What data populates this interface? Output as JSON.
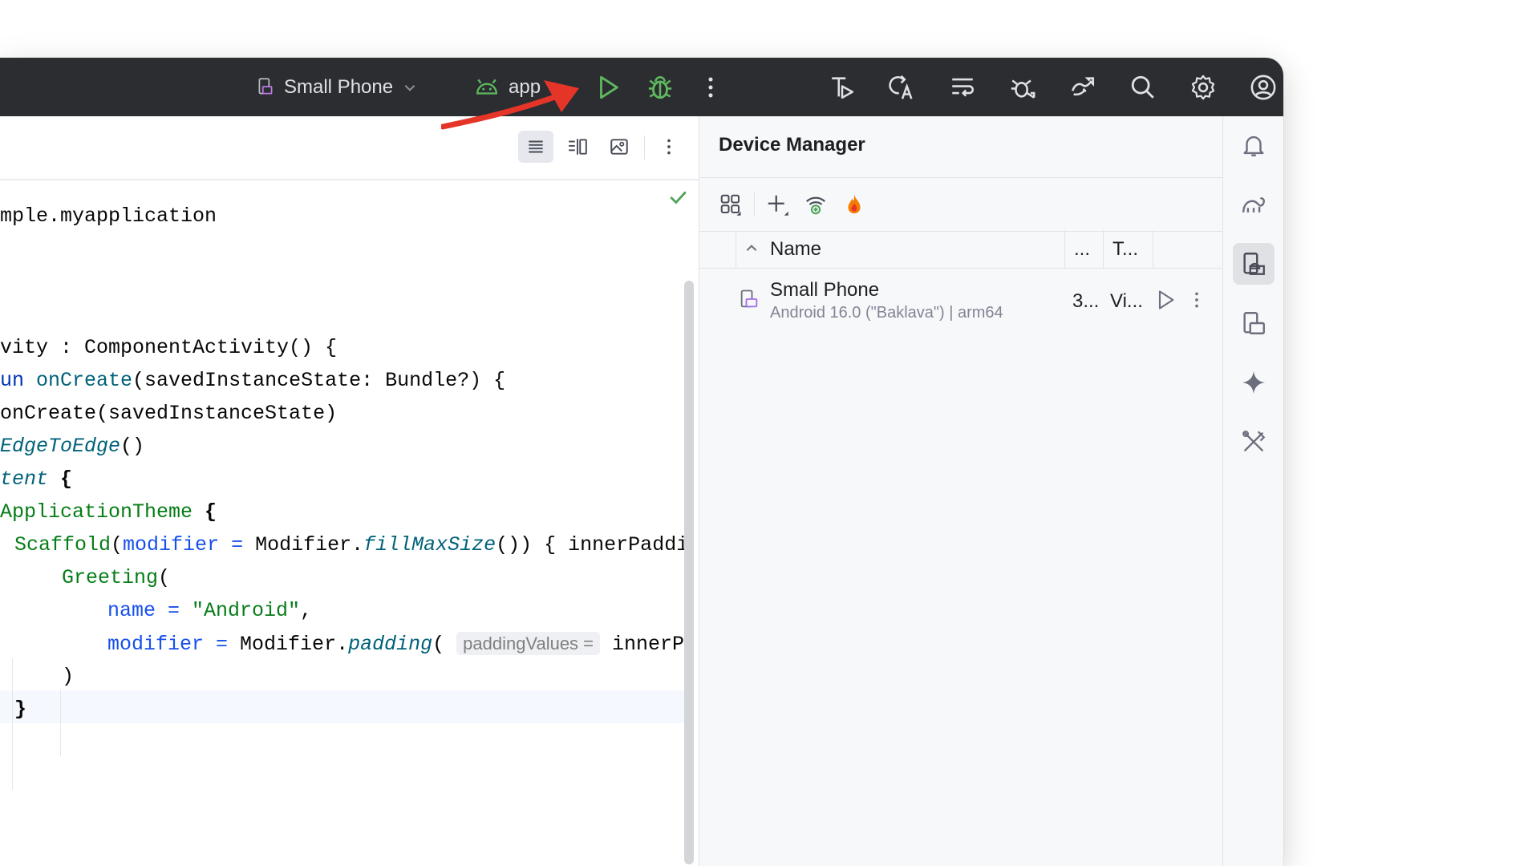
{
  "toolbar": {
    "device_label": "Small Phone",
    "run_config_label": "app",
    "icons": [
      "device-icon",
      "chevron-down-icon",
      "android-icon",
      "run-icon",
      "debug-icon",
      "more-vertical-icon",
      "run-test-icon",
      "translate-icon",
      "wrap-icon",
      "debug-profile-icon",
      "sync-icon",
      "search-icon",
      "gear-icon",
      "account-icon"
    ]
  },
  "editor": {
    "view_modes": [
      "code-view-icon",
      "split-view-icon",
      "design-view-icon"
    ],
    "lines": [
      "mple.myapplication",
      "vity : ComponentActivity() {",
      "un onCreate(savedInstanceState: Bundle?) {",
      "onCreate(savedInstanceState)",
      "EdgeToEdge()",
      "tent {",
      "ApplicationTheme {",
      "Scaffold(modifier = Modifier.fillMaxSize()) { innerPadding",
      "Greeting(",
      "name = \"Android\",",
      "modifier = Modifier.padding( paddingValues = innerPad",
      ")",
      "}"
    ],
    "tokens": {
      "l0": "mple.myapplication",
      "l1": "vity : ComponentActivity() {",
      "l2a": "un ",
      "l2b": "onCreate",
      "l2c": "(savedInstanceState: Bundle?) {",
      "l3": "onCreate(savedInstanceState)",
      "l4a": "EdgeToEdge",
      "l4b": "()",
      "l5a": "tent",
      "l5b": " {",
      "l6a": "ApplicationTheme",
      "l6b": " {",
      "l7a": "Scaffold",
      "l7b": "(",
      "l7c": "modifier",
      "l7d": " = ",
      "l7e": "Modifier.",
      "l7f": "fillMaxSize",
      "l7g": "()) { innerPadding",
      "l8a": "Greeting",
      "l8b": "(",
      "l9a": "name",
      "l9b": " = ",
      "l9c": "\"Android\"",
      "l9d": ",",
      "l10a": "modifier",
      "l10b": " = ",
      "l10c": "Modifier.",
      "l10d": "padding",
      "l10e": "( ",
      "l10hint": "paddingValues =",
      "l10f": " innerPad",
      "l11": ")",
      "l12": "}"
    }
  },
  "device_manager": {
    "title": "Device Manager",
    "columns": {
      "name": "Name",
      "api": "...",
      "type": "T..."
    },
    "devices": [
      {
        "name": "Small Phone",
        "details": "Android 16.0 (\"Baklava\") | arm64",
        "api": "3...",
        "type": "Vi..."
      }
    ]
  },
  "colors": {
    "toolbar_bg": "#2b2d30",
    "run_green": "#5fb85f",
    "arrow_red": "#e53528",
    "gemini_icon": "#6c707e"
  }
}
